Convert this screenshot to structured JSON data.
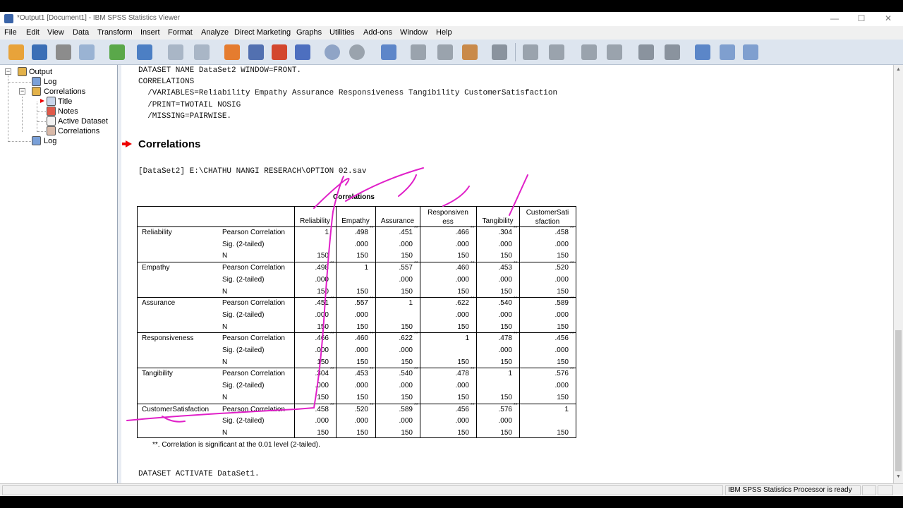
{
  "window": {
    "title": "*Output1 [Document1] - IBM SPSS Statistics Viewer"
  },
  "menu": [
    "File",
    "Edit",
    "View",
    "Data",
    "Transform",
    "Insert",
    "Format",
    "Analyze",
    "Direct Marketing",
    "Graphs",
    "Utilities",
    "Add-ons",
    "Window",
    "Help"
  ],
  "nav": {
    "output": "Output",
    "log1": "Log",
    "correlations": "Correlations",
    "title": "Title",
    "notes": "Notes",
    "active_dataset": "Active Dataset",
    "correlations_table": "Correlations",
    "log2": "Log"
  },
  "syntax": {
    "line1": "DATASET NAME DataSet2 WINDOW=FRONT.",
    "line2": "CORRELATIONS",
    "line3": "  /VARIABLES=Reliability Empathy Assurance Responsiveness Tangibility CustomerSatisfaction",
    "line4": "  /PRINT=TWOTAIL NOSIG",
    "line5": "  /MISSING=PAIRWISE.",
    "heading": "Correlations",
    "dataset": "[DataSet2] E:\\CHATHU NANGI RESERACH\\OPTION 02.sav",
    "activate": "DATASET ACTIVATE DataSet1."
  },
  "table": {
    "title": "Correlations",
    "col_headers": [
      "Reliability",
      "Empathy",
      "Assurance",
      "Responsiven ess",
      "Tangibility",
      "CustomerSati sfaction"
    ],
    "stat_labels": [
      "Pearson Correlation",
      "Sig. (2-tailed)",
      "N"
    ],
    "sig_mark": "**",
    "rows": [
      {
        "name": "Reliability",
        "r": [
          "1",
          ".498",
          ".451",
          ".466",
          ".304",
          ".458"
        ],
        "sig": [
          "",
          ".000",
          ".000",
          ".000",
          ".000",
          ".000"
        ],
        "n": [
          "150",
          "150",
          "150",
          "150",
          "150",
          "150"
        ]
      },
      {
        "name": "Empathy",
        "r": [
          ".498",
          "1",
          ".557",
          ".460",
          ".453",
          ".520"
        ],
        "sig": [
          ".000",
          "",
          ".000",
          ".000",
          ".000",
          ".000"
        ],
        "n": [
          "150",
          "150",
          "150",
          "150",
          "150",
          "150"
        ]
      },
      {
        "name": "Assurance",
        "r": [
          ".451",
          ".557",
          "1",
          ".622",
          ".540",
          ".589"
        ],
        "sig": [
          ".000",
          ".000",
          "",
          ".000",
          ".000",
          ".000"
        ],
        "n": [
          "150",
          "150",
          "150",
          "150",
          "150",
          "150"
        ]
      },
      {
        "name": "Responsiveness",
        "r": [
          ".466",
          ".460",
          ".622",
          "1",
          ".478",
          ".456"
        ],
        "sig": [
          ".000",
          ".000",
          ".000",
          "",
          ".000",
          ".000"
        ],
        "n": [
          "150",
          "150",
          "150",
          "150",
          "150",
          "150"
        ]
      },
      {
        "name": "Tangibility",
        "r": [
          ".304",
          ".453",
          ".540",
          ".478",
          "1",
          ".576"
        ],
        "sig": [
          ".000",
          ".000",
          ".000",
          ".000",
          "",
          ".000"
        ],
        "n": [
          "150",
          "150",
          "150",
          "150",
          "150",
          "150"
        ]
      },
      {
        "name": "CustomerSatisfaction",
        "r": [
          ".458",
          ".520",
          ".589",
          ".456",
          ".576",
          "1"
        ],
        "sig": [
          ".000",
          ".000",
          ".000",
          ".000",
          ".000",
          ""
        ],
        "n": [
          "150",
          "150",
          "150",
          "150",
          "150",
          "150"
        ]
      }
    ],
    "footnote": "**. Correlation is significant at the 0.01 level (2-tailed)."
  },
  "status": {
    "message": "IBM SPSS Statistics Processor is ready"
  }
}
